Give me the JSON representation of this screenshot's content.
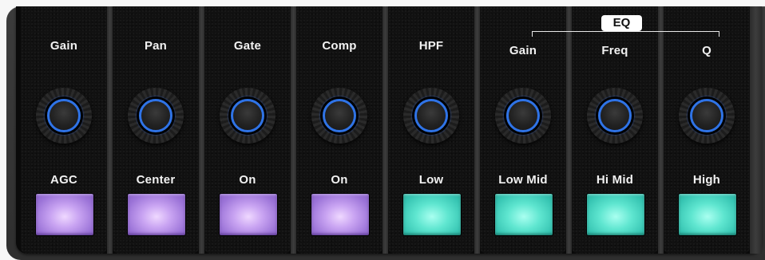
{
  "eq_group": {
    "label": "EQ"
  },
  "channels": [
    {
      "top_label": "Gain",
      "button_label": "AGC",
      "button_color": "#a67fdc"
    },
    {
      "top_label": "Pan",
      "button_label": "Center",
      "button_color": "#a67fdc"
    },
    {
      "top_label": "Gate",
      "button_label": "On",
      "button_color": "#a67fdc"
    },
    {
      "top_label": "Comp",
      "button_label": "On",
      "button_color": "#a67fdc"
    },
    {
      "top_label": "HPF",
      "button_label": "Low",
      "button_color": "#49d3c0"
    },
    {
      "top_label": "Gain",
      "button_label": "Low Mid",
      "button_color": "#49d3c0"
    },
    {
      "top_label": "Freq",
      "button_label": "Hi Mid",
      "button_color": "#49d3c0"
    },
    {
      "top_label": "Q",
      "button_label": "High",
      "button_color": "#49d3c0"
    }
  ],
  "colors": {
    "knob_ring": "#2f73e6",
    "pad_purple": "#a67fdc",
    "pad_teal": "#49d3c0"
  }
}
